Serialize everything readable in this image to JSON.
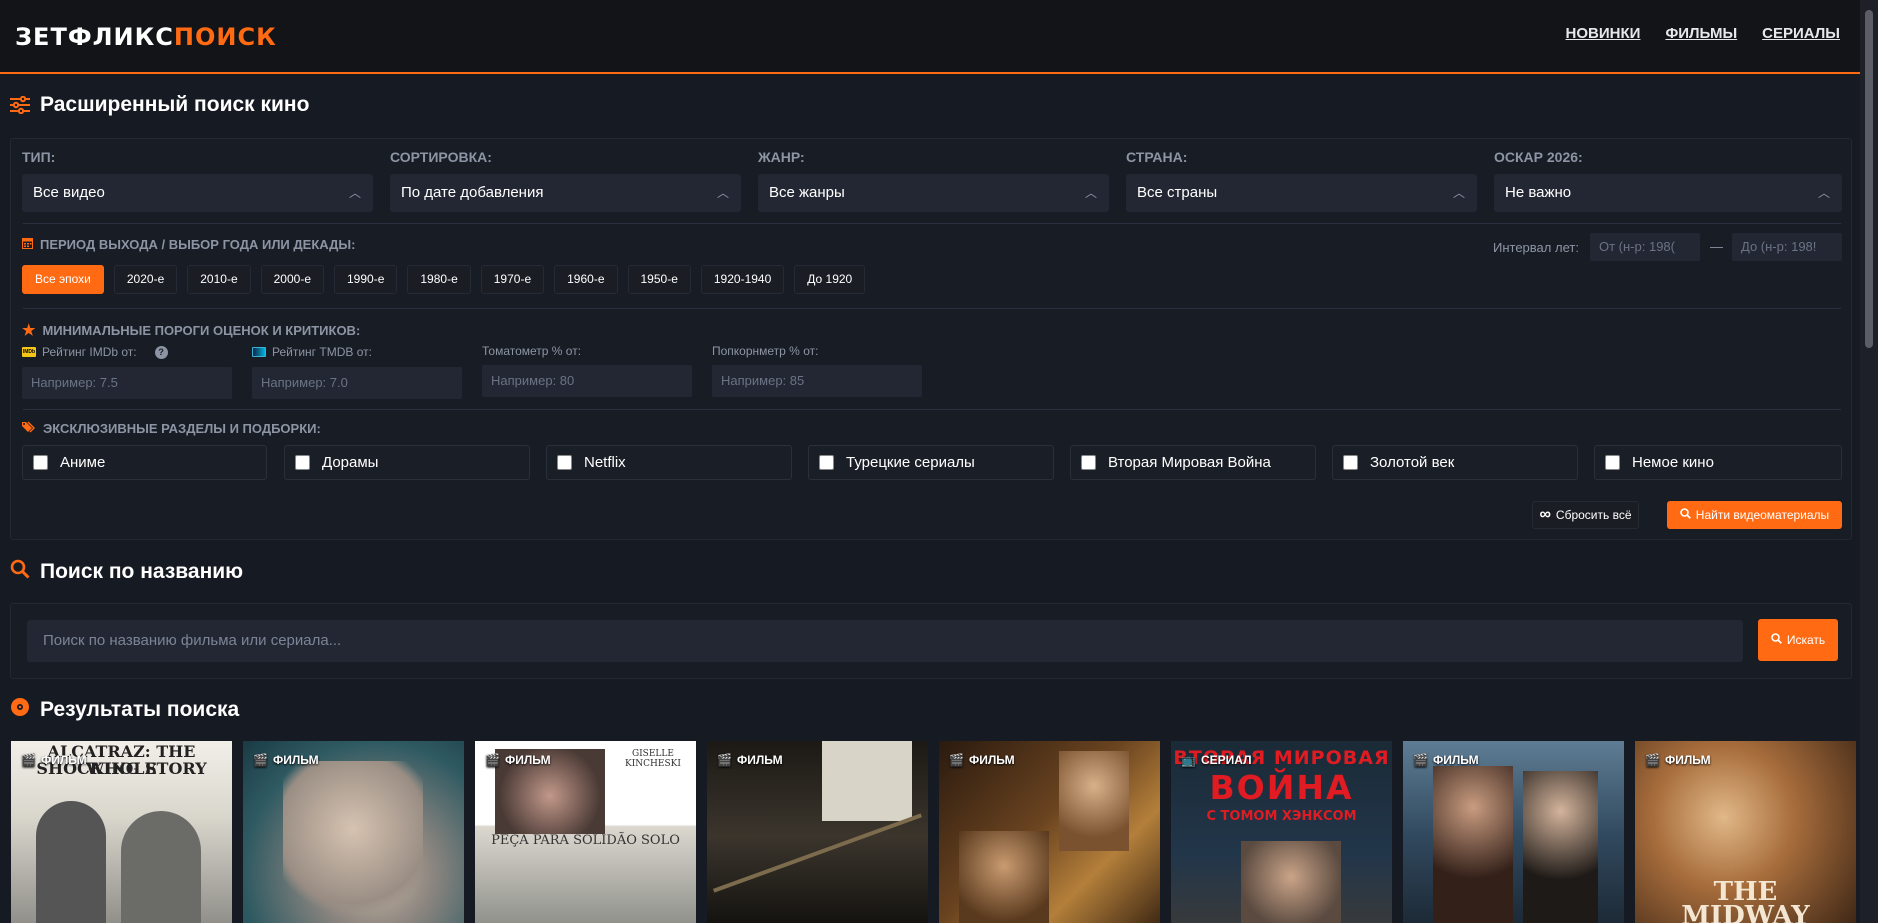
{
  "header": {
    "logo_part1": "ЗЕТФЛИКС",
    "logo_part2": "ПОИСК",
    "nav": [
      "НОВИНКИ",
      "ФИЛЬМЫ",
      "СЕРИАЛЫ"
    ]
  },
  "advanced": {
    "title": "Расширенный поиск кино",
    "filters": [
      {
        "label": "ТИП:",
        "value": "Все видео"
      },
      {
        "label": "СОРТИРОВКА:",
        "value": "По дате добавления"
      },
      {
        "label": "ЖАНР:",
        "value": "Все жанры"
      },
      {
        "label": "СТРАНА:",
        "value": "Все страны"
      },
      {
        "label": "ОСКАР 2026:",
        "value": "Не важно"
      }
    ],
    "period_label": "ПЕРИОД ВЫХОДА / ВЫБОР ГОДА ИЛИ ДЕКАДЫ:",
    "interval_label": "Интервал лет:",
    "interval_from": "От (н-р: 198(",
    "interval_dash": "—",
    "interval_to": "До (н-р: 198!",
    "decades": [
      "Все эпохи",
      "2020-е",
      "2010-е",
      "2000-е",
      "1990-е",
      "1980-е",
      "1970-е",
      "1960-е",
      "1950-е",
      "1920-1940",
      "До 1920"
    ],
    "ratings_label": "МИНИМАЛЬНЫЕ ПОРОГИ ОЦЕНОК И КРИТИКОВ:",
    "ratings": [
      {
        "label": "Рейтинг IMDb от:",
        "placeholder": "Например: 7.5"
      },
      {
        "label": "Рейтинг TMDB от:",
        "placeholder": "Например: 7.0"
      },
      {
        "label": "Томатометр % от:",
        "placeholder": "Например: 80"
      },
      {
        "label": "Попкорнметр % от:",
        "placeholder": "Например: 85"
      }
    ],
    "help_mark": "?",
    "imdb_badge": "IMDb",
    "exclusive_label": "ЭКСКЛЮЗИВНЫЕ РАЗДЕЛЫ И ПОДБОРКИ:",
    "categories": [
      "Аниме",
      "Дорамы",
      "Netflix",
      "Турецкие сериалы",
      "Вторая Мировая Война",
      "Золотой век",
      "Немое кино"
    ],
    "reset_label": "Сбросить всё",
    "find_label": "Найти видеоматериалы"
  },
  "title_search": {
    "title": "Поиск по названию",
    "placeholder": "Поиск по названию фильма или сериала...",
    "button": "Искать"
  },
  "results": {
    "title": "Результаты поиска",
    "cards": [
      {
        "badge": "ФИЛЬМ",
        "text1": "ALCATRAZ: THE WHOLE",
        "text2": "SHOCKING STORY"
      },
      {
        "badge": "ФИЛЬМ"
      },
      {
        "badge": "ФИЛЬМ",
        "text1": "GISELLE",
        "text2": "KINCHESKI",
        "text3": "PEÇA PARA SOLIDÃO SOLO"
      },
      {
        "badge": "ФИЛЬМ"
      },
      {
        "badge": "ФИЛЬМ"
      },
      {
        "badge": "СЕРИАЛ",
        "text1": "ВТОРАЯ МИРОВАЯ",
        "text2": "ВОЙНА",
        "text3": "С ТОМОМ ХЭНКСОМ"
      },
      {
        "badge": "ФИЛЬМ"
      },
      {
        "badge": "ФИЛЬМ",
        "text1": "THE",
        "text2": "MIDWAY"
      }
    ]
  },
  "colors": {
    "accent": "#ff6a13",
    "background": "#161a22",
    "panel": "#181c24",
    "field": "#222733"
  }
}
